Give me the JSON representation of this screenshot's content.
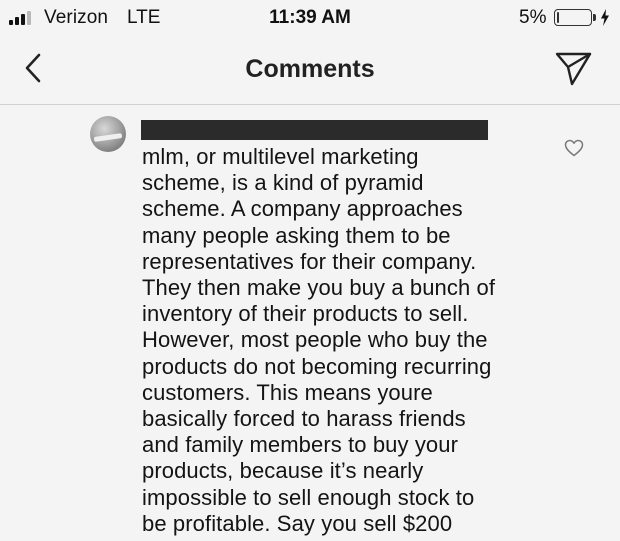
{
  "status_bar": {
    "carrier": "Verizon",
    "network": "LTE",
    "time": "11:39 AM",
    "battery_percent": "5%",
    "battery_level": 0.05,
    "signal_bars_active": 3,
    "icons": [
      "signal-icon",
      "battery-icon",
      "charging-bolt-icon"
    ]
  },
  "nav": {
    "title": "Comments",
    "icons": [
      "back-chevron-icon",
      "direct-share-icon"
    ]
  },
  "comment": {
    "text": "mlm, or multilevel marketing\nscheme, is a kind of pyramid\nscheme. A company approaches\nmany people asking them to be\nrepresentatives for their company.\nThey then make you buy a bunch of\ninventory of their products to sell.\nHowever, most people who buy the\nproducts do not becoming recurring\ncustomers. This means youre\nbasically forced to harass friends\nand family members to buy your\nproducts, because it’s nearly\nimpossible to sell enough stock to\nbe profitable. Say you sell $200",
    "icons": [
      "avatar",
      "heart-icon"
    ]
  },
  "colors": {
    "background": "#f4f4f4",
    "text": "#111111",
    "redaction": "#2b2b2b"
  }
}
